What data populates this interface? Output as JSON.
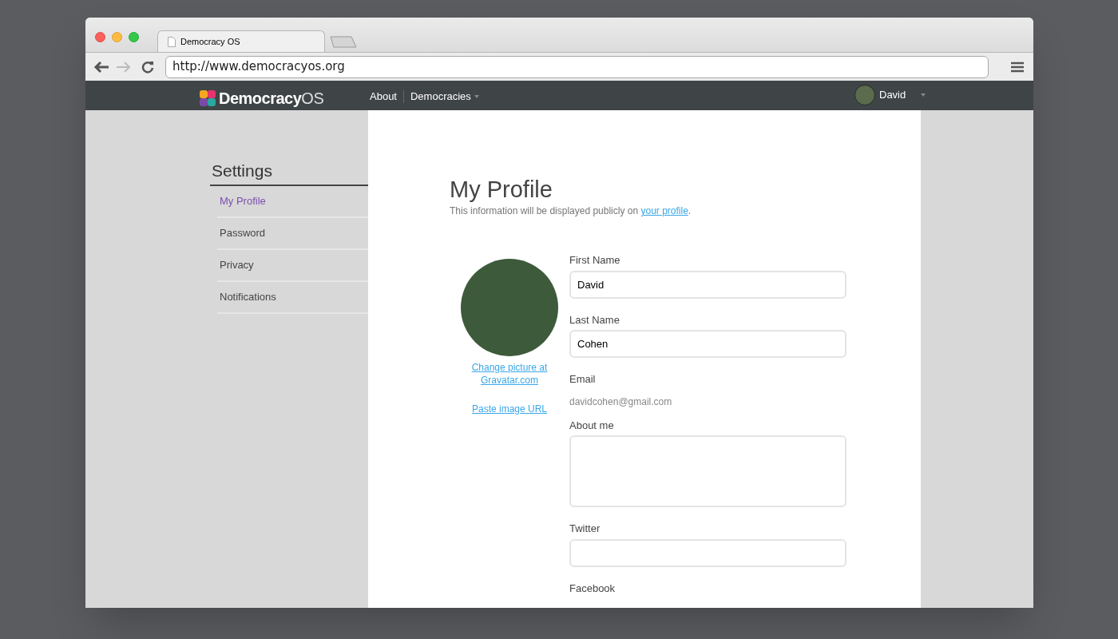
{
  "browser": {
    "tab_title": "Democracy OS",
    "url": "http://www.democracyos.org"
  },
  "navbar": {
    "logo_main": "Democracy",
    "logo_suffix": "OS",
    "links": [
      {
        "label": "About",
        "dropdown": false
      },
      {
        "label": "Democracies",
        "dropdown": true
      }
    ],
    "user": "David"
  },
  "sidebar": {
    "title": "Settings",
    "items": [
      {
        "label": "My Profile",
        "selected": true
      },
      {
        "label": "Password",
        "selected": false
      },
      {
        "label": "Privacy",
        "selected": false
      },
      {
        "label": "Notifications",
        "selected": false
      }
    ]
  },
  "profile": {
    "title": "My Profile",
    "description": "This information will be displayed publicly on ",
    "description_link": "your profile",
    "description_end": ".",
    "picture_links": [
      "Change picture at Gravatar.com",
      "Paste image URL"
    ],
    "fields": [
      {
        "kind": "input",
        "label": "First Name",
        "value": "David"
      },
      {
        "kind": "input",
        "label": "Last Name",
        "value": "Cohen"
      },
      {
        "kind": "static",
        "label": "Email",
        "value": "davidcohen@gmail.com"
      },
      {
        "kind": "textarea",
        "label": "About me"
      },
      {
        "kind": "input",
        "label": "Twitter"
      },
      {
        "kind": "label",
        "label": "Facebook"
      }
    ]
  }
}
